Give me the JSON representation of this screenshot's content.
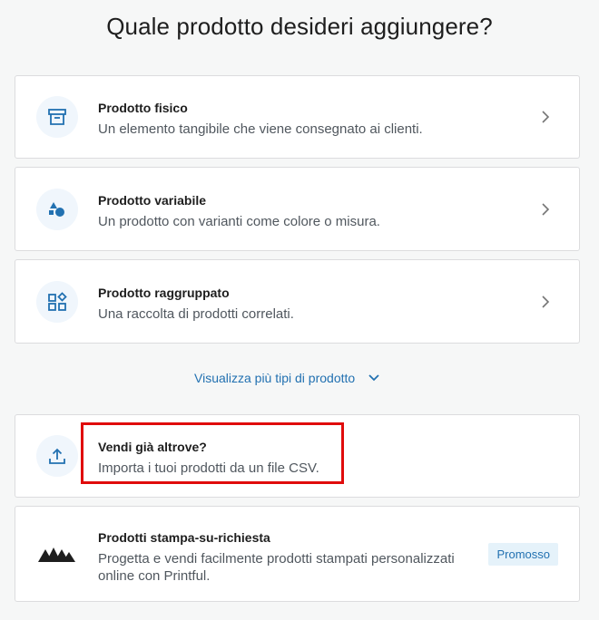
{
  "title": "Quale prodotto desideri aggiungere?",
  "cards": [
    {
      "title": "Prodotto fisico",
      "desc": "Un elemento tangibile che viene consegnato ai clienti.",
      "icon": "archive-box-icon"
    },
    {
      "title": "Prodotto variabile",
      "desc": "Un prodotto con varianti come colore o misura.",
      "icon": "shapes-icon"
    },
    {
      "title": "Prodotto raggruppato",
      "desc": "Una raccolta di prodotti correlati.",
      "icon": "grid-group-icon"
    }
  ],
  "more_link": "Visualizza più tipi di prodotto",
  "csv_card": {
    "title": "Vendi già altrove?",
    "desc": "Importa i tuoi prodotti da un file CSV.",
    "icon": "upload-icon"
  },
  "printful_card": {
    "title": "Prodotti stampa-su-richiesta",
    "desc_line1": "Progetta e vendi facilmente prodotti stampati personalizzati",
    "desc_line2": "online con Printful.",
    "badge": "Promosso",
    "icon": "printful-logo-icon"
  },
  "colors": {
    "accent": "#2271b1",
    "highlight": "#e00c0c"
  }
}
